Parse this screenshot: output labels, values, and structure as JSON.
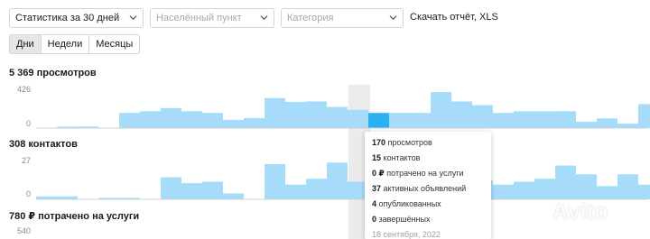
{
  "filters": {
    "period": "Статистика за 30 дней",
    "city_placeholder": "Населённый пункт",
    "category_placeholder": "Категория",
    "download": "Скачать отчёт, XLS"
  },
  "granularity": {
    "options": [
      "Дни",
      "Недели",
      "Месяцы"
    ],
    "active": "Дни"
  },
  "metrics": {
    "views_title": "5 369 просмотров",
    "contacts_title": "308 контактов",
    "spent_title": "780 ₽ потрачено на услуги"
  },
  "tooltip": {
    "views_count": "170",
    "views_label": "просмотров",
    "contacts_count": "15",
    "contacts_label": "контактов",
    "spent_amount": "0 ₽",
    "spent_label": "потрачено на услуги",
    "active_count": "37",
    "active_label": "активных объявлений",
    "published_count": "4",
    "published_label": "опубликованных",
    "finished_count": "0",
    "finished_label": "завершённых",
    "date": "18 сентября, 2022"
  },
  "watermark": "Avito",
  "colors": {
    "bar": "#a6dcfa",
    "bar_highlight": "#2bb0f0",
    "column_highlight": "#ebebeb"
  },
  "chart_data": [
    {
      "type": "bar",
      "title": "5 369 просмотров",
      "y_ticks": [
        "426",
        "0"
      ],
      "ylim": [
        0,
        426
      ],
      "highlight_index": 16,
      "values": [
        0,
        4,
        18,
        0,
        170,
        190,
        225,
        190,
        170,
        92,
        112,
        337,
        295,
        300,
        238,
        205,
        170,
        170,
        170,
        405,
        300,
        258,
        170,
        189,
        189,
        190,
        70,
        108,
        50,
        270,
        170,
        133
      ]
    },
    {
      "type": "bar",
      "title": "308 контактов",
      "y_ticks": [
        "27",
        "0"
      ],
      "ylim": [
        0,
        27
      ],
      "highlight_index": 16,
      "values": [
        2,
        2,
        0,
        1,
        1,
        0,
        15,
        11,
        12,
        4,
        0,
        24,
        10,
        14,
        25,
        12,
        15,
        16,
        13,
        15,
        21,
        13,
        10,
        12,
        14,
        23,
        17,
        9,
        17,
        10,
        14,
        14
      ]
    },
    {
      "type": "bar",
      "title": "780 ₽ потрачено на услуги",
      "y_ticks": [
        "540"
      ],
      "ylim": [
        0,
        540
      ],
      "highlight_index": 16,
      "values": []
    }
  ]
}
